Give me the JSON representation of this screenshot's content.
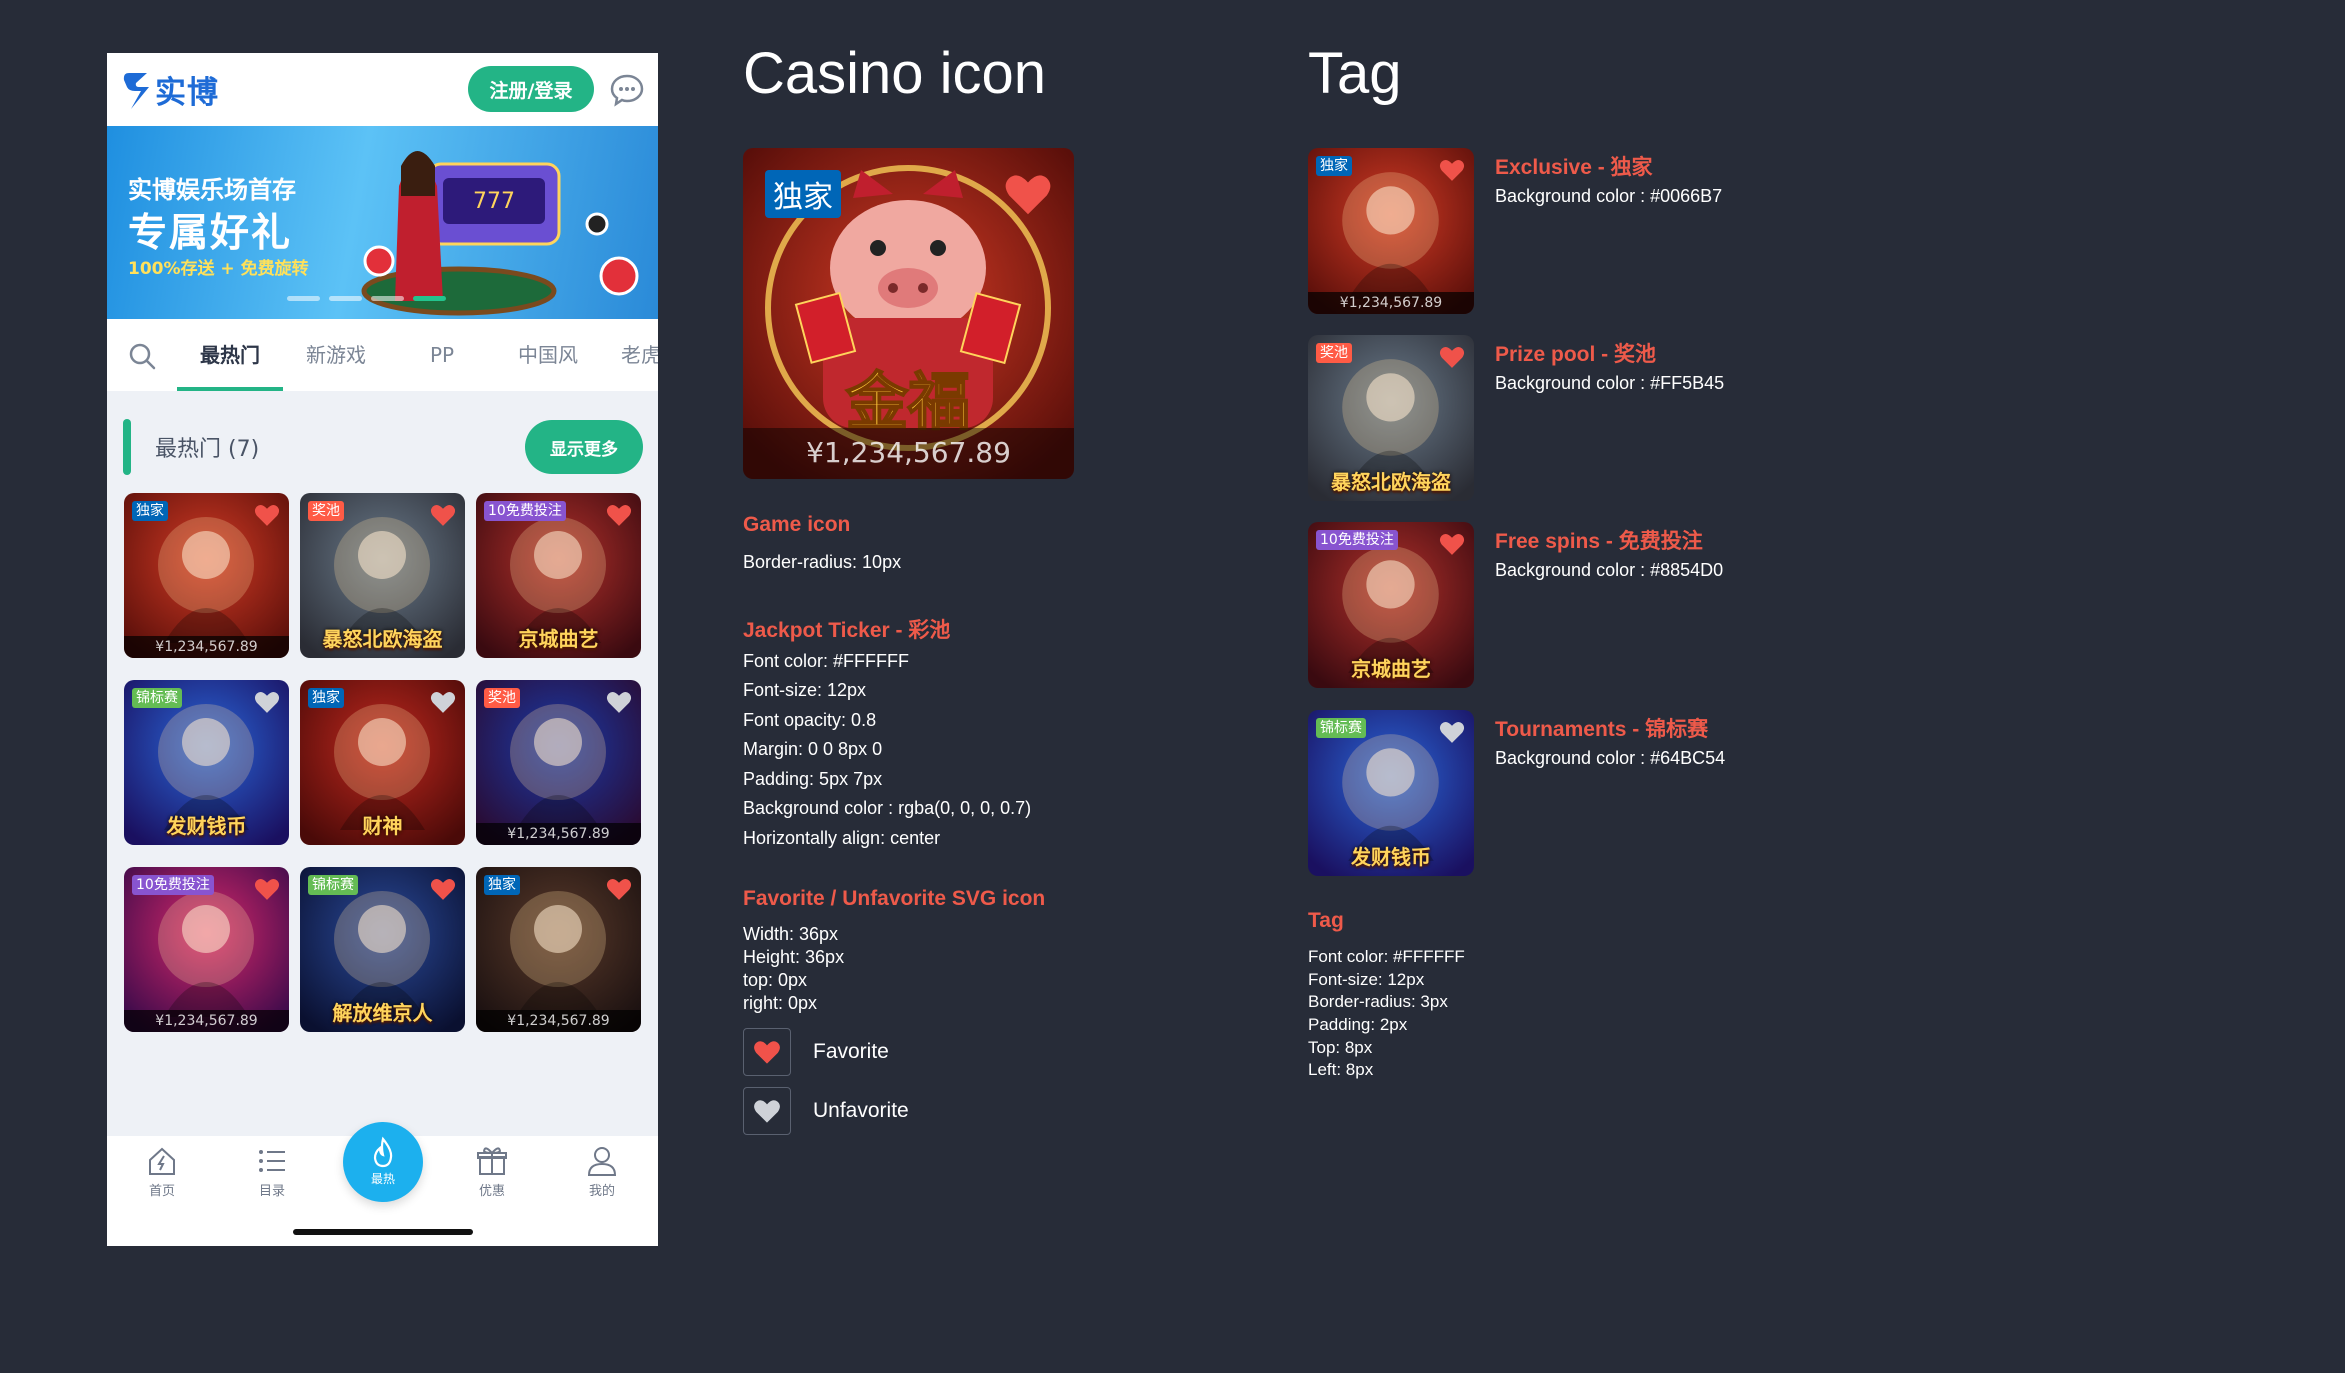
{
  "phone": {
    "logo_text": "实博",
    "login_label": "注册/登录",
    "banner": {
      "title": "实博娱乐场首存",
      "main": "专属好礼",
      "sub": "100%存送 + 免费旋转"
    },
    "tabs": [
      "最热门",
      "新游戏",
      "PP",
      "中国风",
      "老虎"
    ],
    "section_title": "最热门 (7)",
    "more_label": "显示更多",
    "games": [
      {
        "tag": "独家",
        "tag_color": "#0066B7",
        "name": "",
        "ticker": "¥1,234,567.89",
        "fav": true
      },
      {
        "tag": "奖池",
        "tag_color": "#FF5B45",
        "name": "暴怒北欧海盗",
        "ticker": "",
        "fav": true
      },
      {
        "tag": "10免费投注",
        "tag_color": "#8854D0",
        "name": "京城曲艺",
        "ticker": "",
        "fav": true
      },
      {
        "tag": "锦标赛",
        "tag_color": "#64BC54",
        "name": "发财钱币",
        "ticker": "",
        "fav": false
      },
      {
        "tag": "独家",
        "tag_color": "#0066B7",
        "name": "财神",
        "ticker": "",
        "fav": false
      },
      {
        "tag": "奖池",
        "tag_color": "#FF5B45",
        "name": "",
        "ticker": "¥1,234,567.89",
        "fav": false
      },
      {
        "tag": "10免费投注",
        "tag_color": "#8854D0",
        "name": "",
        "ticker": "¥1,234,567.89",
        "fav": true
      },
      {
        "tag": "锦标赛",
        "tag_color": "#64BC54",
        "name": "解放维京人",
        "ticker": "",
        "fav": true
      },
      {
        "tag": "独家",
        "tag_color": "#0066B7",
        "name": "",
        "ticker": "¥1,234,567.89",
        "fav": true
      }
    ],
    "nav": [
      "首页",
      "目录",
      "最热",
      "优惠",
      "我的"
    ]
  },
  "casino": {
    "title": "Casino icon",
    "big_tag": "独家",
    "big_ticker": "¥1,234,567.89",
    "game_icon_h": "Game icon",
    "game_icon_lines": [
      "Border-radius: 10px"
    ],
    "ticker_h": "Jackpot Ticker - 彩池",
    "ticker_lines": [
      "Font color: #FFFFFF",
      "Font-size: 12px",
      "Font opacity: 0.8",
      "Margin: 0 0 8px 0",
      "Padding: 5px 7px",
      "Background color : rgba(0, 0, 0, 0.7)",
      "Horizontally align: center"
    ],
    "fav_h": "Favorite  / Unfavorite SVG icon",
    "fav_lines": [
      "Width: 36px",
      "Height: 36px",
      "top: 0px",
      "right: 0px"
    ],
    "favorite_label": "Favorite",
    "unfavorite_label": "Unfavorite"
  },
  "tag": {
    "title": "Tag",
    "items": [
      {
        "tag": "独家",
        "heading": "Exclusive - 独家",
        "bg": "Background color : #0066B7",
        "color": "#0066B7",
        "name": "",
        "ticker": "¥1,234,567.89"
      },
      {
        "tag": "奖池",
        "heading": "Prize pool - 奖池",
        "bg": "Background color : #FF5B45",
        "color": "#FF5B45",
        "name": "暴怒北欧海盗",
        "ticker": ""
      },
      {
        "tag": "10免费投注",
        "heading": "Free spins - 免费投注",
        "bg": "Background color : #8854D0",
        "color": "#8854D0",
        "name": "京城曲艺",
        "ticker": ""
      },
      {
        "tag": "锦标赛",
        "heading": "Tournaments - 锦标赛",
        "bg": "Background color : #64BC54",
        "color": "#64BC54",
        "name": "发财钱币",
        "ticker": ""
      }
    ],
    "spec_h": "Tag",
    "spec_lines": [
      "Font color: #FFFFFF",
      "Font-size: 12px",
      "Border-radius: 3px",
      "Padding: 2px",
      "Top: 8px",
      "Left: 8px"
    ]
  },
  "colors": {
    "accent": "#23b486",
    "heading": "#ee5a4a",
    "background": "#272c38",
    "heart": "#f0524a"
  }
}
